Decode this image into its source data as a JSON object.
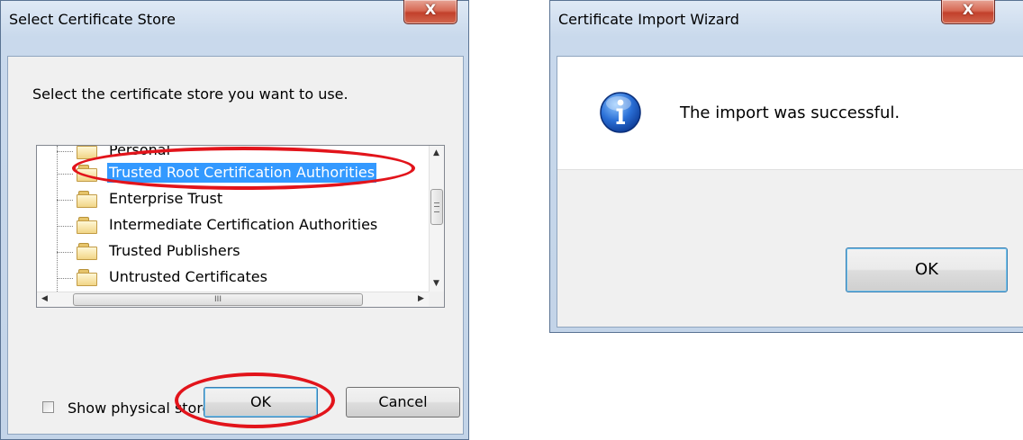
{
  "store_dialog": {
    "title": "Select Certificate Store",
    "close_glyph": "X",
    "prompt": "Select the certificate store you want to use.",
    "stores": [
      {
        "label": "Personal",
        "selected": false
      },
      {
        "label": "Trusted Root Certification Authorities",
        "selected": true
      },
      {
        "label": "Enterprise Trust",
        "selected": false
      },
      {
        "label": "Intermediate Certification Authorities",
        "selected": false
      },
      {
        "label": "Trusted Publishers",
        "selected": false
      },
      {
        "label": "Untrusted Certificates",
        "selected": false
      }
    ],
    "hscroll_grip": "III",
    "show_physical_label": "Show physical stores",
    "show_physical_checked": false,
    "ok_label": "OK",
    "cancel_label": "Cancel"
  },
  "wizard_dialog": {
    "title": "Certificate Import Wizard",
    "close_glyph": "X",
    "icon": "info-icon",
    "message": "The import was successful.",
    "ok_label": "OK"
  },
  "colors": {
    "selection": "#3399ff",
    "highlight_annotation": "#e2141b"
  }
}
